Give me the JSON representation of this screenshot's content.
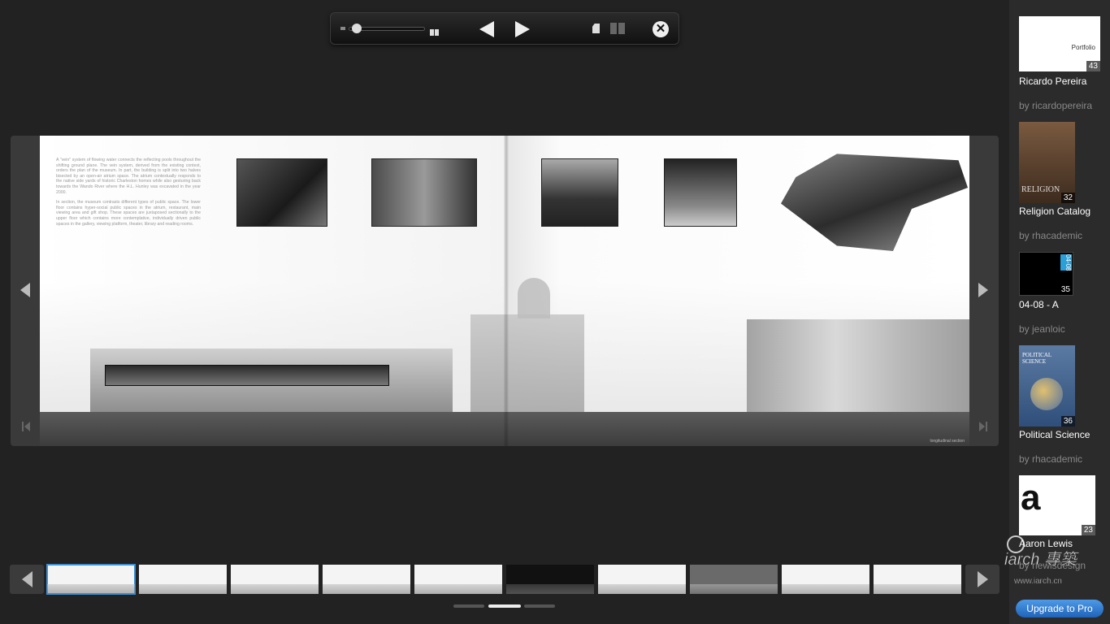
{
  "toolbar": {
    "zoom_level_fraction": 0.05
  },
  "page_text": {
    "para1": "A \"vein\" system of flowing water connects the reflecting pools throughout the shifting ground plane. The vein system, derived from the existing context, orders the plan of the museum. In part, the building is split into two halves bisected by an open-air atrium space. The atrium contextually responds to the native side yards of historic Charleston homes while also gesturing back towards the Wando River where the H.L. Hunley was excavated in the year 2000.",
    "para2": "In section, the museum contrasts different types of public space. The lower floor contains hyper-social public spaces in the atrium, restaurant, main viewing area and gift shop. These spaces are juxtaposed sectionally to the upper floor which contains more contemplative, individually driven public spaces in the gallery, viewing platform, theater, library and reading rooms.",
    "credit": "longitudinal section"
  },
  "sidebar": {
    "items": [
      {
        "title": "Ricardo Pereira",
        "author": "by ricardopereira",
        "pages": "43",
        "cover_text": "Portfolio"
      },
      {
        "title": "Religion Catalog",
        "author": "by rhacademic",
        "pages": "32",
        "cover_text": "RELIGION"
      },
      {
        "title": "04-08 - A",
        "author": "by jeanloic",
        "pages": "35",
        "cover_text": "04-08"
      },
      {
        "title": "Political Science",
        "author": "by rhacademic",
        "pages": "36",
        "cover_text": "POLITICAL SCIENCE"
      },
      {
        "title": "Aaron Lewis",
        "author": "by rlewisdesign",
        "pages": "23",
        "cover_text": "a"
      }
    ],
    "upgrade_label": "Upgrade to Pro"
  },
  "watermark": {
    "text": "iarch 專築",
    "url": "www.iarch.cn"
  },
  "colors": {
    "background": "#222222",
    "accent": "#3a8fd6",
    "upgrade_button": "#2a76cc"
  }
}
